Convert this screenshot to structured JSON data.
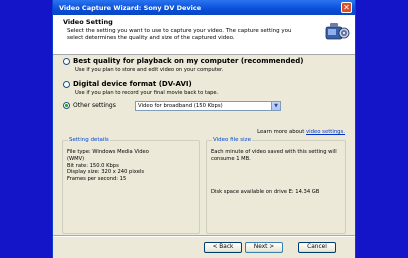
{
  "window": {
    "title": "Video Capture Wizard: Sony DV Device",
    "close_glyph": "✕"
  },
  "header": {
    "title": "Video Setting",
    "description": "Select the setting you want to use to capture your video. The capture setting you select determines the quality and size of the captured video.",
    "icon": "camcorder-icon"
  },
  "options": [
    {
      "label": "Best quality for playback on my computer (recommended)",
      "hint": "Use if you plan to store and edit video on your computer.",
      "selected": false
    },
    {
      "label": "Digital device format (DV-AVI)",
      "hint": "Use if you plan to record your final movie back to tape.",
      "selected": false
    },
    {
      "label": "Other settings",
      "selected": true,
      "select_value": "Video for broadband (150 Kbps)"
    }
  ],
  "learn_more": {
    "prefix": "Learn more about",
    "link": "video settings."
  },
  "details": {
    "title": "Setting details",
    "lines": [
      "File type: Windows Media Video",
      "(WMV)",
      "Bit rate: 150.0 Kbps",
      "Display size: 320 x 240 pixels",
      "Frames per second: 15"
    ]
  },
  "filesize": {
    "title": "Video file size",
    "text": "Each minute of video saved with this setting will consume 1 MB.",
    "space": "Disk space available on drive E: 14.34 GB"
  },
  "buttons": {
    "back": "< Back",
    "next": "Next >",
    "cancel": "Cancel"
  },
  "colors": {
    "title_bar": "#0a4fd8",
    "desktop": "#1414c8",
    "group_title": "#0046d5"
  }
}
